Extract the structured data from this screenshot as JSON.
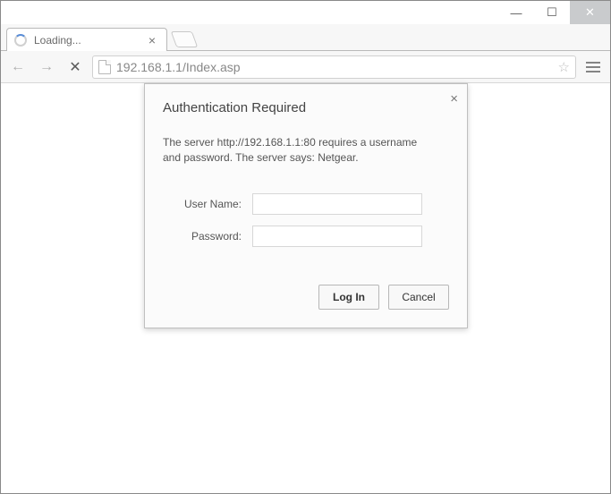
{
  "window": {
    "minimize_glyph": "—",
    "maximize_glyph": "☐",
    "close_glyph": "✕"
  },
  "tab": {
    "title": "Loading...",
    "close_glyph": "×"
  },
  "toolbar": {
    "back_glyph": "←",
    "forward_glyph": "→",
    "stop_glyph": "✕",
    "url": "192.168.1.1/Index.asp",
    "star_glyph": "☆"
  },
  "dialog": {
    "title": "Authentication Required",
    "close_glyph": "×",
    "message": "The server http://192.168.1.1:80 requires a username and password. The server says: Netgear.",
    "username_label": "User Name:",
    "password_label": "Password:",
    "username_value": "",
    "password_value": "",
    "login_label": "Log In",
    "cancel_label": "Cancel"
  }
}
